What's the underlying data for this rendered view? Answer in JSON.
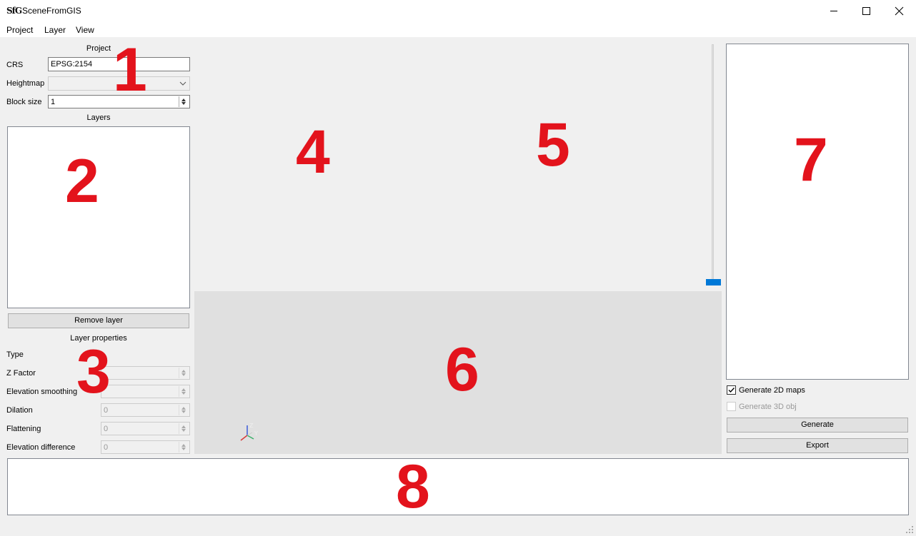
{
  "window": {
    "title": "SceneFromGIS",
    "logo_text": "SfG",
    "controls": {
      "minimize": "minimize-icon",
      "maximize": "maximize-icon",
      "close": "close-icon"
    }
  },
  "menu": [
    "Project",
    "Layer",
    "View"
  ],
  "project_panel": {
    "title": "Project",
    "crs_label": "CRS",
    "crs_value": "EPSG:2154",
    "heightmap_label": "Heightmap",
    "heightmap_value": "",
    "block_size_label": "Block size",
    "block_size_value": "1"
  },
  "layers_panel": {
    "title": "Layers",
    "remove_button": "Remove layer"
  },
  "layer_properties": {
    "title": "Layer properties",
    "type_label": "Type",
    "z_factor_label": "Z Factor",
    "elevation_smoothing_label": "Elevation smoothing",
    "dilation_label": "Dilation",
    "dilation_value": "0",
    "flattening_label": "Flattening",
    "flattening_value": "0",
    "elevation_difference_label": "Elevation difference",
    "elevation_difference_value": "0"
  },
  "view3d": {
    "axis_labels": [
      "Z",
      "Y"
    ]
  },
  "right_panel": {
    "generate_2d_label": "Generate 2D maps",
    "generate_2d_checked": true,
    "generate_3d_label": "Generate 3D obj",
    "generate_3d_checked": false,
    "generate_button": "Generate",
    "export_button": "Export"
  },
  "annotations": [
    "1",
    "2",
    "3",
    "4",
    "5",
    "6",
    "7",
    "8"
  ],
  "colors": {
    "annotation": "#e3131c",
    "slider_handle": "#0078d7"
  }
}
